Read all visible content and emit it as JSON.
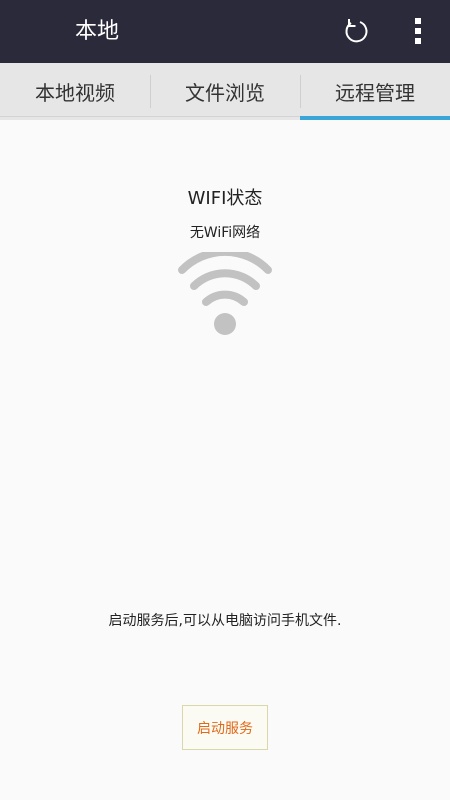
{
  "header": {
    "title": "本地",
    "refresh_icon": "refresh-icon",
    "more_icon": "more-vertical-icon"
  },
  "tabs": [
    {
      "label": "本地视频",
      "active": false
    },
    {
      "label": "文件浏览",
      "active": false
    },
    {
      "label": "远程管理",
      "active": true
    }
  ],
  "main": {
    "wifi_title": "WIFI状态",
    "wifi_status": "无WiFi网络",
    "wifi_icon": "wifi-icon",
    "description": "启动服务后,可以从电脑访问手机文件.",
    "start_button": "启动服务"
  },
  "colors": {
    "topbar": "#2a2a3a",
    "tab_bg": "#e6e6e6",
    "tab_active_underline": "#3aa5d6",
    "wifi_icon": "#c2c2c2",
    "button_text": "#e06a1a"
  }
}
